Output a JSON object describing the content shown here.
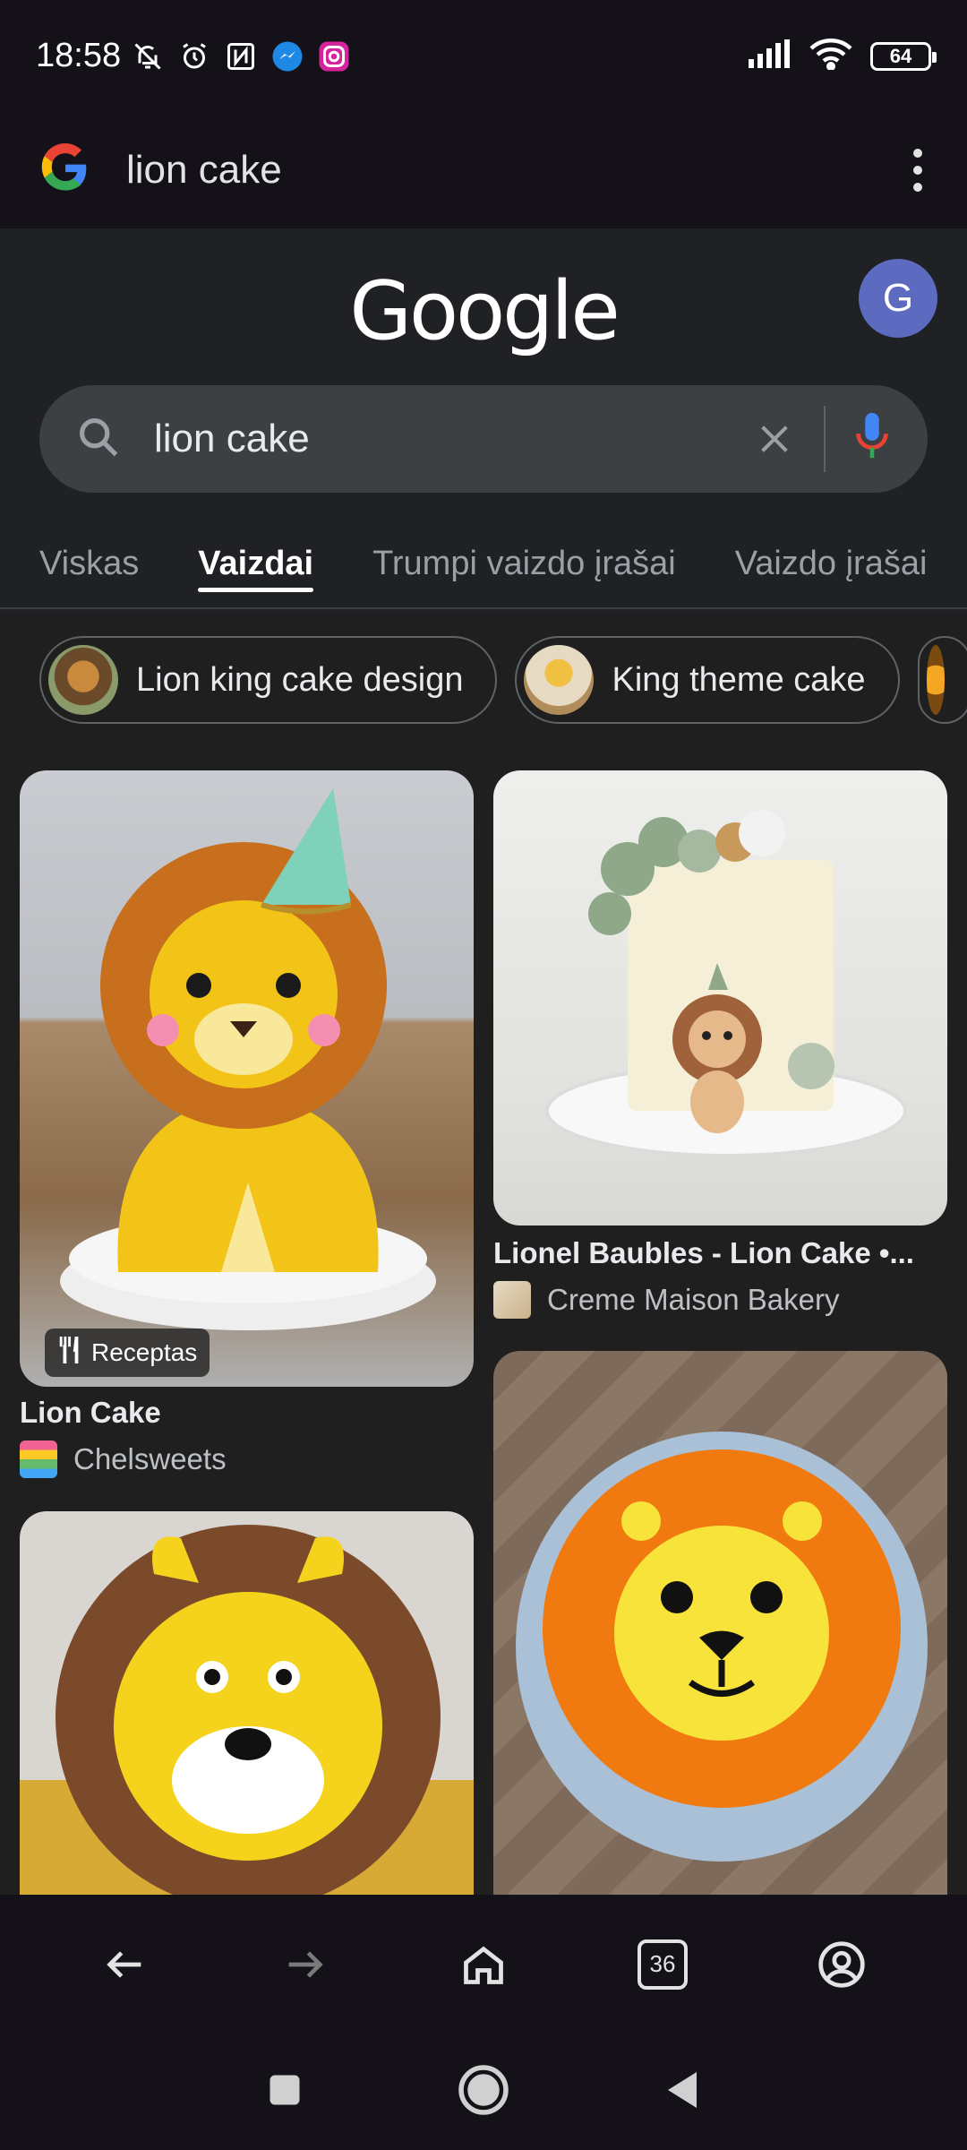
{
  "status_bar": {
    "time": "18:58",
    "icons_left": [
      "bell-off-icon",
      "alarm-icon",
      "nfc-icon",
      "messenger-icon",
      "instagram-icon"
    ],
    "battery": "64"
  },
  "url_bar": {
    "query": "lion cake"
  },
  "google": {
    "logo": "Google",
    "avatar_letter": "G"
  },
  "search": {
    "value": "lion cake"
  },
  "tabs": [
    {
      "label": "Viskas",
      "active": false
    },
    {
      "label": "Vaizdai",
      "active": true
    },
    {
      "label": "Trumpi vaizdo įrašai",
      "active": false
    },
    {
      "label": "Vaizdo įrašai",
      "active": false
    }
  ],
  "chips": [
    {
      "label": "Lion king cake design"
    },
    {
      "label": "King theme cake"
    }
  ],
  "results": [
    {
      "title": "Lion Cake",
      "source": "Chelsweets",
      "badge": "Receptas"
    },
    {
      "title": "Lionel Baubles - Lion Cake •...",
      "source": "Creme Maison Bakery"
    }
  ],
  "bottom_nav": {
    "tab_count": "36"
  },
  "colors": {
    "background": "#202124",
    "bar": "#141218",
    "accent_avatar": "#5c6bc0"
  }
}
